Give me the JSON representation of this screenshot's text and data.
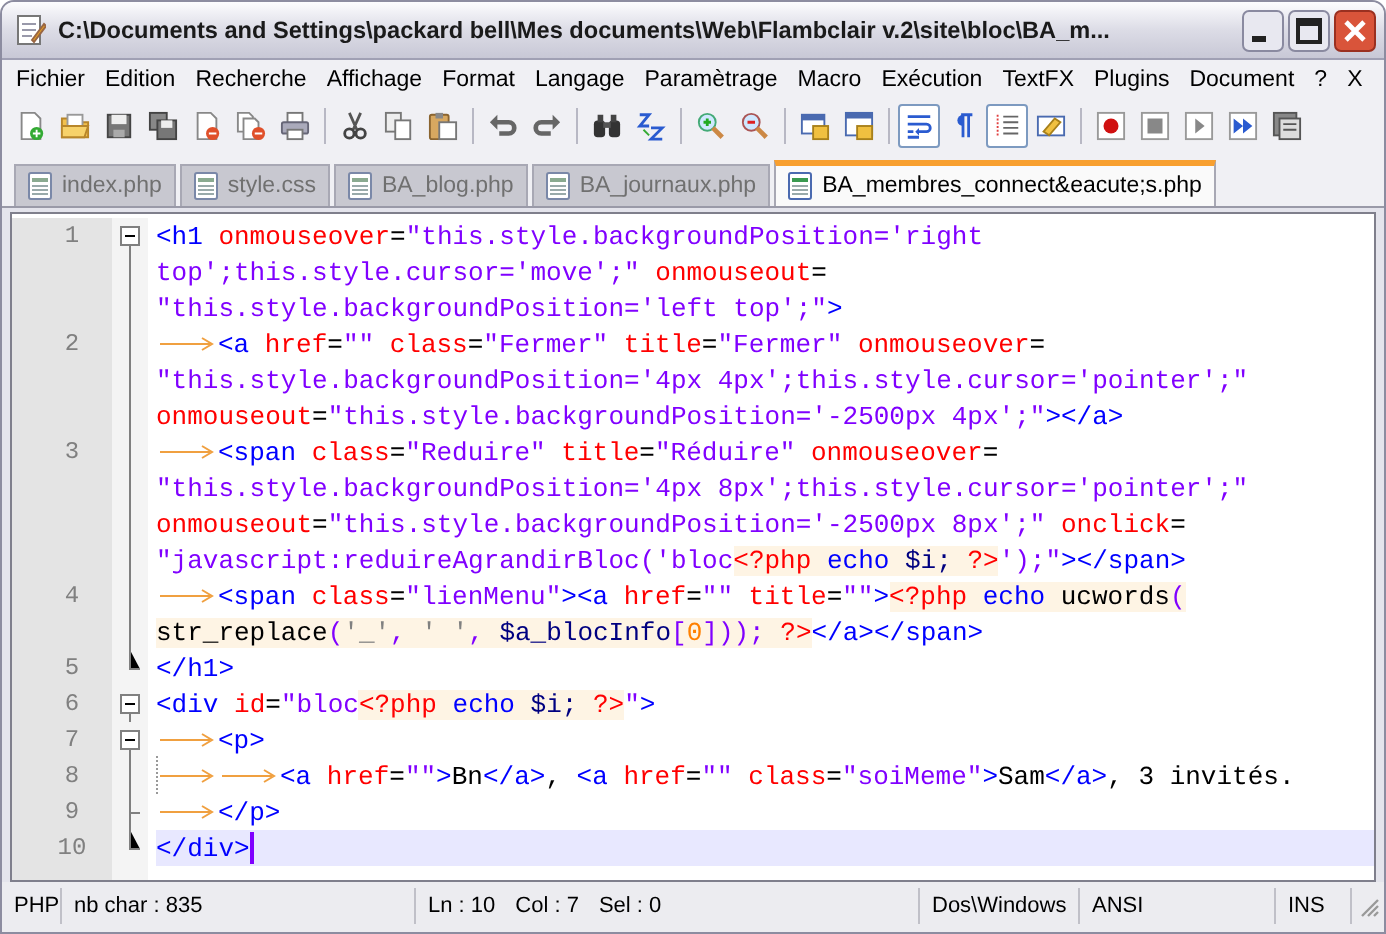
{
  "window": {
    "title": "C:\\Documents and Settings\\packard bell\\Mes documents\\Web\\Flambclair v.2\\site\\bloc\\BA_m..."
  },
  "menu": [
    "Fichier",
    "Edition",
    "Recherche",
    "Affichage",
    "Format",
    "Langage",
    "Paramètrage",
    "Macro",
    "Exécution",
    "TextFX",
    "Plugins",
    "Document",
    "?"
  ],
  "menu_close": "X",
  "toolbar": [
    [
      {
        "pressed": false
      },
      {
        "pressed": false
      },
      {
        "pressed": false
      },
      {
        "pressed": false
      },
      {
        "pressed": false
      },
      {
        "pressed": false
      },
      {
        "pressed": false
      }
    ],
    [
      {
        "pressed": false
      },
      {
        "pressed": false
      },
      {
        "pressed": false
      }
    ],
    [
      {
        "pressed": false
      },
      {
        "pressed": false
      }
    ],
    [
      {
        "pressed": false
      },
      {
        "pressed": false
      }
    ],
    [
      {
        "pressed": false
      },
      {
        "pressed": false
      }
    ],
    [
      {
        "pressed": false
      },
      {
        "pressed": false
      }
    ],
    [
      {
        "pressed": true
      },
      {
        "pressed": false
      },
      {
        "pressed": true
      },
      {
        "pressed": false
      }
    ],
    [
      {
        "pressed": false
      },
      {
        "pressed": false
      },
      {
        "pressed": false
      },
      {
        "pressed": false
      },
      {
        "pressed": false
      }
    ]
  ],
  "tabs": [
    {
      "label": "index.php",
      "selected": false
    },
    {
      "label": "style.css",
      "selected": false
    },
    {
      "label": "BA_blog.php",
      "selected": false
    },
    {
      "label": "BA_journaux.php",
      "selected": false
    },
    {
      "label": "BA_membres_connect&eacute;s.php",
      "selected": true
    }
  ],
  "editor": {
    "lines": [
      {
        "number": "1",
        "current": false,
        "rows": [
          {
            "kind": "box",
            "tokens": [
              {
                "kind": "tag",
                "text": "<h1"
              },
              {
                "kind": "attr",
                "text": " onmouseover"
              },
              {
                "kind": "plain",
                "text": "="
              },
              {
                "kind": "value",
                "text": "\"this.style.backgroundPosition='right "
              }
            ]
          },
          {
            "kind": "line",
            "tokens": [
              {
                "kind": "value",
                "text": "top';this.style.cursor='move';\""
              },
              {
                "kind": "attr",
                "text": " onmouseout"
              },
              {
                "kind": "plain",
                "text": "="
              }
            ]
          },
          {
            "kind": "line",
            "tokens": [
              {
                "kind": "value",
                "text": "\"this.style.backgroundPosition='left top';\""
              },
              {
                "kind": "tag",
                "text": ">"
              }
            ]
          }
        ]
      },
      {
        "number": "2",
        "current": false,
        "rows": [
          {
            "kind": "line",
            "tokens": [
              {
                "kind": "tab"
              },
              {
                "kind": "tag",
                "text": "<a"
              },
              {
                "kind": "attr",
                "text": " href"
              },
              {
                "kind": "plain",
                "text": "="
              },
              {
                "kind": "value",
                "text": "\"\""
              },
              {
                "kind": "attr",
                "text": " class"
              },
              {
                "kind": "plain",
                "text": "="
              },
              {
                "kind": "value",
                "text": "\"Fermer\""
              },
              {
                "kind": "attr",
                "text": " title"
              },
              {
                "kind": "plain",
                "text": "="
              },
              {
                "kind": "value",
                "text": "\"Fermer\""
              },
              {
                "kind": "attr",
                "text": " onmouseover"
              },
              {
                "kind": "plain",
                "text": "="
              }
            ]
          },
          {
            "kind": "line",
            "tokens": [
              {
                "kind": "value",
                "text": "\"this.style.backgroundPosition='4px 4px';this.style.cursor='pointer';\""
              }
            ]
          },
          {
            "kind": "line",
            "tokens": [
              {
                "kind": "attr",
                "text": "onmouseout"
              },
              {
                "kind": "plain",
                "text": "="
              },
              {
                "kind": "value",
                "text": "\"this.style.backgroundPosition='-2500px 4px';\""
              },
              {
                "kind": "tag",
                "text": "></a>"
              }
            ]
          }
        ]
      },
      {
        "number": "3",
        "current": false,
        "rows": [
          {
            "kind": "line",
            "tokens": [
              {
                "kind": "tab"
              },
              {
                "kind": "tag",
                "text": "<span"
              },
              {
                "kind": "attr",
                "text": " class"
              },
              {
                "kind": "plain",
                "text": "="
              },
              {
                "kind": "value",
                "text": "\"Reduire\""
              },
              {
                "kind": "attr",
                "text": " title"
              },
              {
                "kind": "plain",
                "text": "="
              },
              {
                "kind": "value",
                "text": "\"Réduire\""
              },
              {
                "kind": "attr",
                "text": " onmouseover"
              },
              {
                "kind": "plain",
                "text": "="
              }
            ]
          },
          {
            "kind": "line",
            "tokens": [
              {
                "kind": "value",
                "text": "\"this.style.backgroundPosition='4px 8px';this.style.cursor='pointer';\""
              }
            ]
          },
          {
            "kind": "line",
            "tokens": [
              {
                "kind": "attr",
                "text": "onmouseout"
              },
              {
                "kind": "plain",
                "text": "="
              },
              {
                "kind": "value",
                "text": "\"this.style.backgroundPosition='-2500px 8px';\""
              },
              {
                "kind": "attr",
                "text": " onclick"
              },
              {
                "kind": "plain",
                "text": "="
              }
            ]
          },
          {
            "kind": "line",
            "tokens": [
              {
                "kind": "value",
                "text": "\"javascript:reduireAgrandirBloc('bloc"
              },
              {
                "kind": "phpdelim",
                "text": "<?php"
              },
              {
                "kind": "phpkw",
                "text": " echo"
              },
              {
                "kind": "phpvar",
                "text": " $i;"
              },
              {
                "kind": "phpdelim",
                "text": " ?>"
              },
              {
                "kind": "value",
                "text": "');\""
              },
              {
                "kind": "tag",
                "text": "></span>"
              }
            ]
          }
        ]
      },
      {
        "number": "4",
        "current": false,
        "rows": [
          {
            "kind": "line",
            "tokens": [
              {
                "kind": "tab"
              },
              {
                "kind": "tag",
                "text": "<span"
              },
              {
                "kind": "attr",
                "text": " class"
              },
              {
                "kind": "plain",
                "text": "="
              },
              {
                "kind": "value",
                "text": "\"lienMenu\""
              },
              {
                "kind": "tag",
                "text": "><a"
              },
              {
                "kind": "attr",
                "text": " href"
              },
              {
                "kind": "plain",
                "text": "="
              },
              {
                "kind": "value",
                "text": "\"\""
              },
              {
                "kind": "attr",
                "text": " title"
              },
              {
                "kind": "plain",
                "text": "="
              },
              {
                "kind": "value",
                "text": "\"\""
              },
              {
                "kind": "tag",
                "text": ">"
              },
              {
                "kind": "phpdelim",
                "text": "<?php"
              },
              {
                "kind": "phpkw",
                "text": " echo"
              },
              {
                "kind": "phpfn",
                "text": " ucwords"
              },
              {
                "kind": "phpop",
                "text": "("
              }
            ]
          },
          {
            "kind": "line",
            "tokens": [
              {
                "kind": "phpfn",
                "text": "str_replace"
              },
              {
                "kind": "phpop",
                "text": "("
              },
              {
                "kind": "phpstr",
                "text": "'_'"
              },
              {
                "kind": "phpop",
                "text": ","
              },
              {
                "kind": "phpstr",
                "text": " ' '"
              },
              {
                "kind": "phpop",
                "text": ","
              },
              {
                "kind": "phpvar",
                "text": " $a_blocInfo"
              },
              {
                "kind": "phpop",
                "text": "["
              },
              {
                "kind": "phpnum",
                "text": "0"
              },
              {
                "kind": "phpop",
                "text": "]));"
              },
              {
                "kind": "phpdelim",
                "text": " ?>"
              },
              {
                "kind": "tag",
                "text": "</a></span>"
              }
            ]
          }
        ]
      },
      {
        "number": "5",
        "current": false,
        "rows": [
          {
            "kind": "end",
            "tokens": [
              {
                "kind": "tag",
                "text": "</h1>"
              }
            ]
          }
        ]
      },
      {
        "number": "6",
        "current": false,
        "rows": [
          {
            "kind": "box",
            "tokens": [
              {
                "kind": "tag",
                "text": "<div"
              },
              {
                "kind": "attr",
                "text": " id"
              },
              {
                "kind": "plain",
                "text": "="
              },
              {
                "kind": "value",
                "text": "\"bloc"
              },
              {
                "kind": "phpdelim",
                "text": "<?php"
              },
              {
                "kind": "phpkw",
                "text": " echo"
              },
              {
                "kind": "phpvar",
                "text": " $i;"
              },
              {
                "kind": "phpdelim",
                "text": " ?>"
              },
              {
                "kind": "value",
                "text": "\""
              },
              {
                "kind": "tag",
                "text": ">"
              }
            ]
          }
        ]
      },
      {
        "number": "7",
        "current": false,
        "rows": [
          {
            "kind": "box",
            "tokens": [
              {
                "kind": "tab"
              },
              {
                "kind": "tag",
                "text": "<p>"
              }
            ]
          }
        ]
      },
      {
        "number": "8",
        "current": false,
        "rows": [
          {
            "kind": "line",
            "tokens": [
              {
                "kind": "tab"
              },
              {
                "kind": "guide"
              },
              {
                "kind": "tab"
              },
              {
                "kind": "tag",
                "text": "<a"
              },
              {
                "kind": "attr",
                "text": " href"
              },
              {
                "kind": "plain",
                "text": "="
              },
              {
                "kind": "value",
                "text": "\"\""
              },
              {
                "kind": "tag",
                "text": ">"
              },
              {
                "kind": "plain",
                "text": "Bn"
              },
              {
                "kind": "tag",
                "text": "</a>"
              },
              {
                "kind": "plain",
                "text": ", "
              },
              {
                "kind": "tag",
                "text": "<a"
              },
              {
                "kind": "attr",
                "text": " href"
              },
              {
                "kind": "plain",
                "text": "="
              },
              {
                "kind": "value",
                "text": "\"\""
              },
              {
                "kind": "attr",
                "text": " class"
              },
              {
                "kind": "plain",
                "text": "="
              },
              {
                "kind": "value",
                "text": "\"soiMeme\""
              },
              {
                "kind": "tag",
                "text": ">"
              },
              {
                "kind": "plain",
                "text": "Sam"
              },
              {
                "kind": "tag",
                "text": "</a>"
              },
              {
                "kind": "plain",
                "text": ", 3 invités."
              }
            ]
          }
        ]
      },
      {
        "number": "9",
        "current": false,
        "rows": [
          {
            "kind": "tee",
            "tokens": [
              {
                "kind": "tab"
              },
              {
                "kind": "tag",
                "text": "</p>"
              }
            ]
          }
        ]
      },
      {
        "number": "10",
        "current": true,
        "rows": [
          {
            "kind": "end",
            "tokens": [
              {
                "kind": "tag",
                "text": "</div>"
              }
            ]
          }
        ]
      }
    ]
  },
  "status_bar": {
    "language": "PHP",
    "length": "nb char : 835",
    "line": "Ln : 10",
    "column": "Col : 7",
    "selection": "Sel : 0",
    "eol": "Dos\\Windows",
    "encoding": "ANSI",
    "mode": "INS"
  }
}
